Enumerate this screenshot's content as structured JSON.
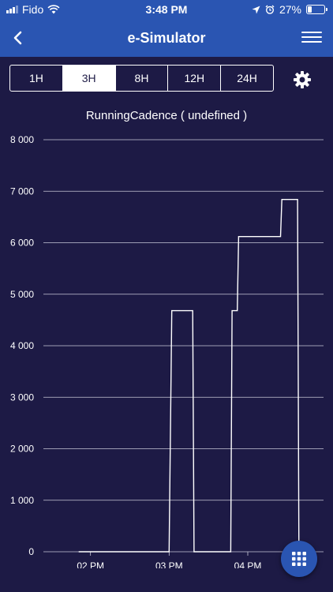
{
  "status_bar": {
    "carrier": "Fido",
    "time": "3:48 PM",
    "battery_percent": "27%",
    "battery_level": 0.27
  },
  "header": {
    "title": "e-Simulator"
  },
  "range_tabs": {
    "items": [
      "1H",
      "3H",
      "8H",
      "12H",
      "24H"
    ],
    "selected": "3H"
  },
  "colors": {
    "background": "#1d1a45",
    "header": "#2a55b2",
    "line": "#ffffff"
  },
  "chart_data": {
    "type": "line",
    "title": "RunningCadence ( undefined )",
    "y_ticks": [
      "0",
      "1 000",
      "2 000",
      "3 000",
      "4 000",
      "5 000",
      "6 000",
      "7 000",
      "8 000"
    ],
    "x_ticks": [
      "02 PM",
      "03 PM",
      "04 PM"
    ],
    "ylim": [
      0,
      8000
    ],
    "grid": true,
    "legend": "none",
    "series": [
      {
        "x": [
          "13:51",
          "15:00",
          "15:02",
          "15:18",
          "15:19",
          "15:47",
          "15:48",
          "15:52",
          "15:53",
          "16:25",
          "16:26",
          "16:38",
          "16:39"
        ],
        "y": [
          0,
          0,
          4680,
          4680,
          0,
          0,
          4680,
          4680,
          6120,
          6120,
          6840,
          6840,
          0
        ]
      }
    ]
  }
}
